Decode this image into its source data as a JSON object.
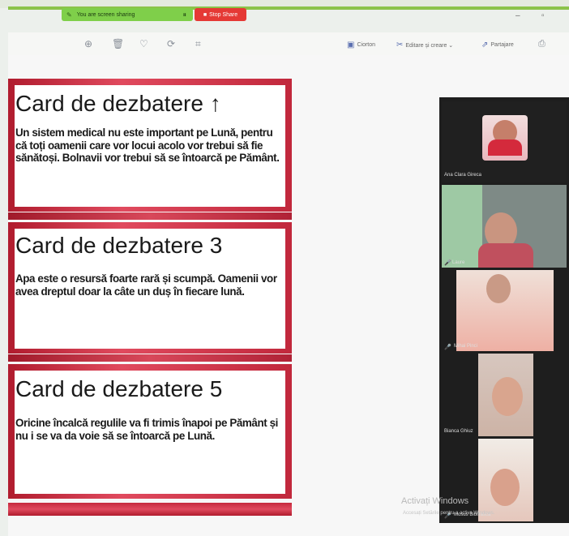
{
  "share_bar": {
    "status": "You are screen sharing",
    "stop_label": "Stop Share"
  },
  "window": {
    "minimize": "‒",
    "maximize": "▫"
  },
  "toolbar": {
    "tools": [
      {
        "name": "zoom-in-icon",
        "glyph": "⊕"
      },
      {
        "name": "delete-icon",
        "glyph": "🗑"
      },
      {
        "name": "heart-icon",
        "glyph": "♡"
      },
      {
        "name": "rotate-icon",
        "glyph": "⟳"
      },
      {
        "name": "crop-icon",
        "glyph": "⌗"
      }
    ],
    "right": [
      {
        "name": "caption-button",
        "icon": "▣",
        "label": "Ciorton"
      },
      {
        "name": "edit-create-button",
        "icon": "✂",
        "label": "Editare și creare ⌄"
      },
      {
        "name": "share-button",
        "icon": "⇗",
        "label": "Partajare"
      }
    ],
    "print_icon": "⎙"
  },
  "cards": [
    {
      "title": "Card de dezbatere ↑",
      "body": "Un sistem medical nu este important pe Lună, pentru că toți oamenii care vor locui acolo vor trebui să fie sănătoși. Bolnavii vor trebui să se întoarcă pe Pământ."
    },
    {
      "title": "Card de dezbatere 3",
      "body": "Apa este o resursă foarte rară și scumpă. Oamenii vor avea dreptul doar la câte un duș în fiecare lună."
    },
    {
      "title": "Card de dezbatere 5",
      "body": "Oricine încalcă regulile va fi trimis înapoi pe Pământ și nu i se va da voie să se întoarcă pe Lună."
    }
  ],
  "participants": [
    {
      "name": "Ana Clara Gireca"
    },
    {
      "name": "Laure"
    },
    {
      "name": "Mihai Pinci"
    },
    {
      "name": "Bianca Ghiuz"
    },
    {
      "name": "Mosus Biolirasca"
    }
  ],
  "watermark": {
    "line1": "Activați Windows",
    "line2": "Accesați Setările pentru a activa Windows."
  }
}
